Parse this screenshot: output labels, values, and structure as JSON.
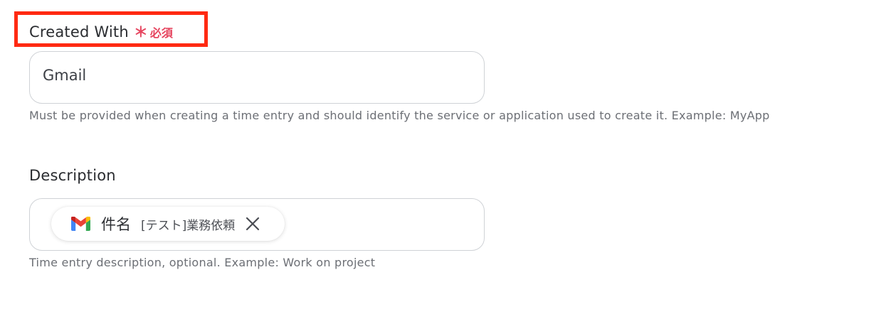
{
  "fields": {
    "created_with": {
      "label": "Created With",
      "required_mark": "＊",
      "required_text": "必須",
      "value": "Gmail",
      "help": "Must be provided when creating a time entry and should identify the service or application used to create it. Example: MyApp"
    },
    "description": {
      "label": "Description",
      "chip": {
        "icon": "gmail-icon",
        "field": "件名",
        "value": "[テスト]業務依頼",
        "remove_icon": "close-icon"
      },
      "help": "Time entry description, optional. Example: Work on project"
    }
  },
  "colors": {
    "highlight_border": "#ff2a12",
    "required": "#e6455f",
    "input_border": "#cfd2d6",
    "help_text": "#6c6f75"
  }
}
